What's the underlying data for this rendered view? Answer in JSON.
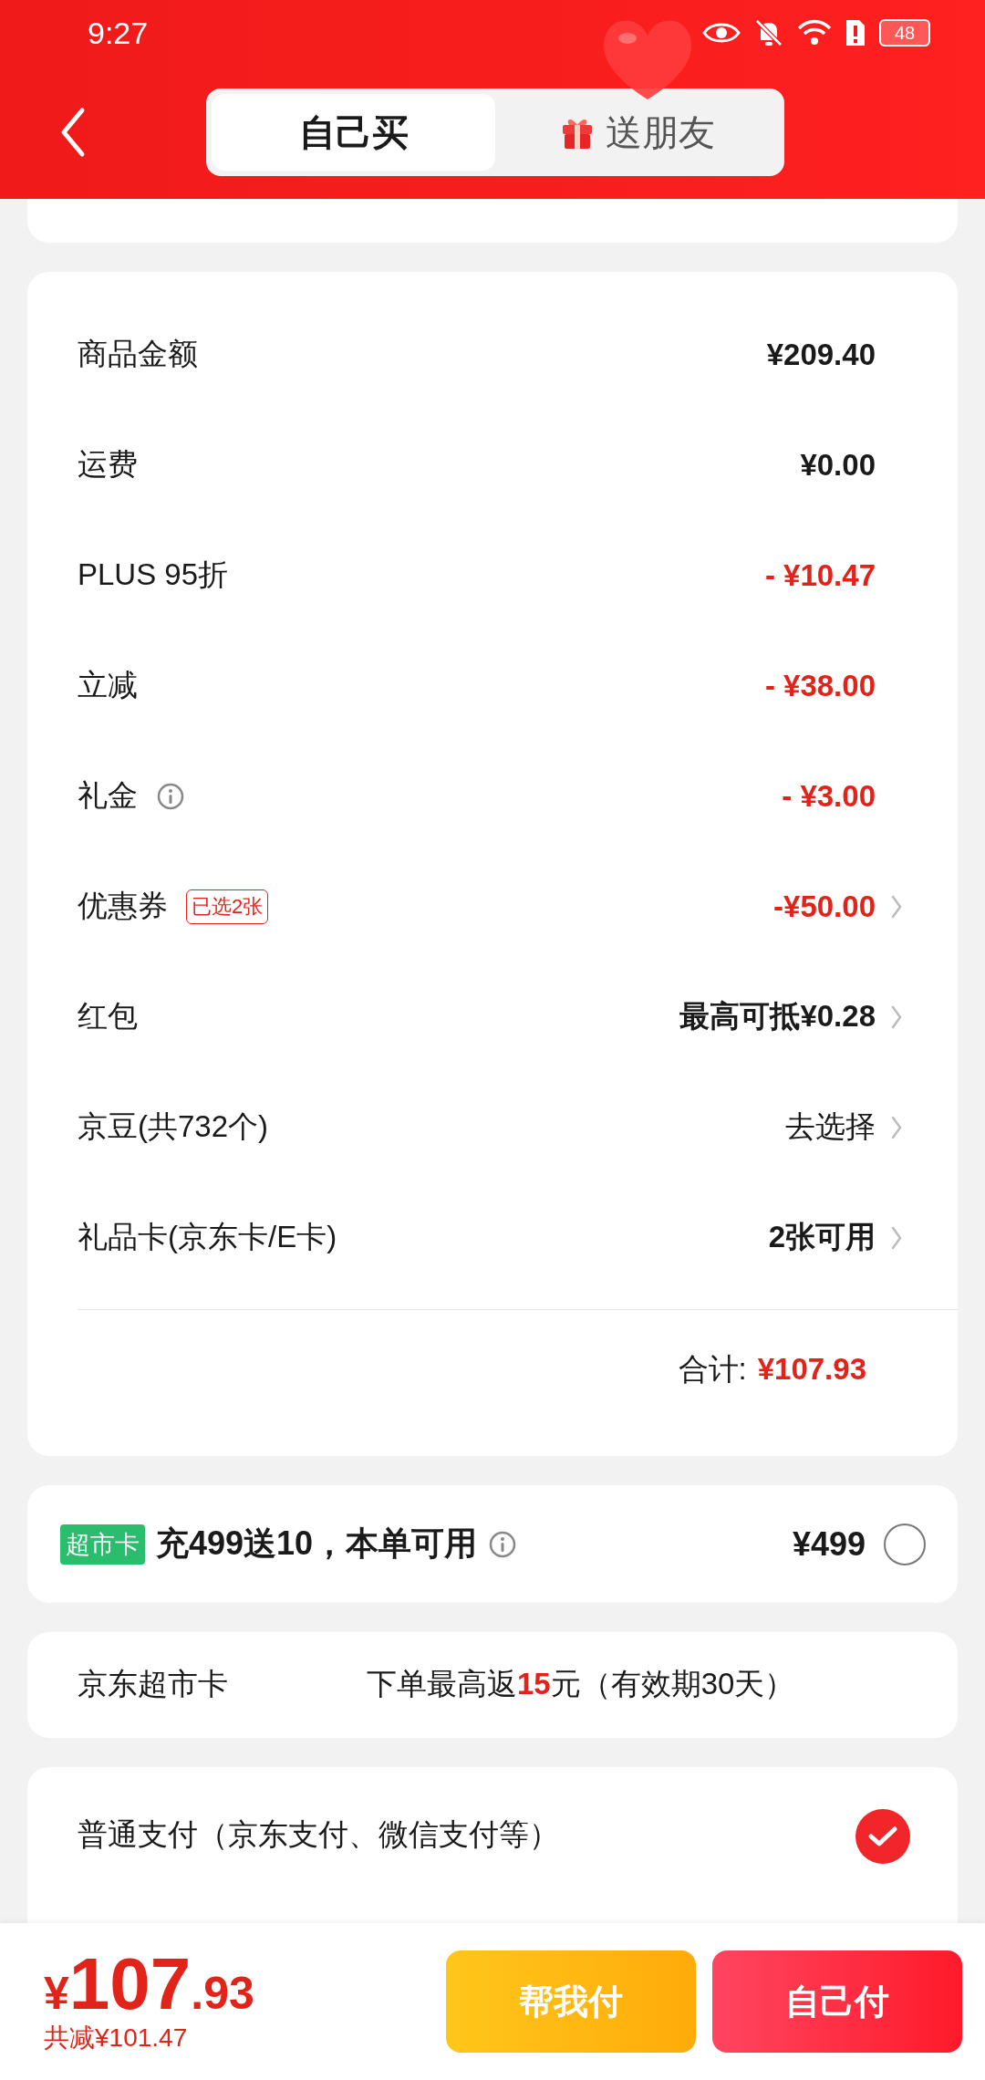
{
  "status_bar": {
    "time": "9:27",
    "battery": "48"
  },
  "header": {
    "tabs": [
      {
        "label": "自己买",
        "selected": true,
        "gift": false
      },
      {
        "label": "送朋友",
        "selected": false,
        "gift": true
      }
    ]
  },
  "summary": {
    "rows": [
      {
        "label": "商品金额",
        "value": "¥209.40",
        "kind": "normal",
        "info": false,
        "chevron": false
      },
      {
        "label": "运费",
        "value": "¥0.00",
        "kind": "normal",
        "info": false,
        "chevron": false
      },
      {
        "label": "PLUS 95折",
        "value": "- ¥10.47",
        "kind": "discount",
        "info": false,
        "chevron": false
      },
      {
        "label": "立减",
        "value": "- ¥38.00",
        "kind": "discount",
        "info": false,
        "chevron": false
      },
      {
        "label": "礼金",
        "value": "- ¥3.00",
        "kind": "discount",
        "info": true,
        "chevron": false
      },
      {
        "label": "优惠券",
        "tag": "已选2张",
        "value": "-¥50.00",
        "kind": "discount",
        "info": false,
        "chevron": true
      },
      {
        "label": "红包",
        "value": "最高可抵¥0.28",
        "kind": "normal",
        "info": false,
        "chevron": true
      },
      {
        "label": "京豆(共732个)",
        "value": "去选择",
        "kind": "plain",
        "info": false,
        "chevron": true
      },
      {
        "label": "礼品卡(京东卡/E卡)",
        "value": "2张可用",
        "kind": "normal",
        "info": false,
        "chevron": true
      }
    ],
    "total_label": "合计:",
    "total_value": "¥107.93"
  },
  "promo": {
    "badge": "超市卡",
    "title": "充499送10，本单可用",
    "price": "¥499",
    "selected": false
  },
  "card_info": {
    "name": "京东超市卡",
    "note_before": "下单最高返",
    "note_highlight": "15",
    "note_after": "元（有效期30天）"
  },
  "payment": {
    "label": "普通支付（京东支付、微信支付等）",
    "selected": true
  },
  "bottom": {
    "currency": "¥",
    "integer": "107",
    "decimal": ".93",
    "saved": "共减¥101.47",
    "buttons": [
      {
        "label": "帮我付",
        "kind": "help"
      },
      {
        "label": "自己付",
        "kind": "self"
      }
    ]
  }
}
